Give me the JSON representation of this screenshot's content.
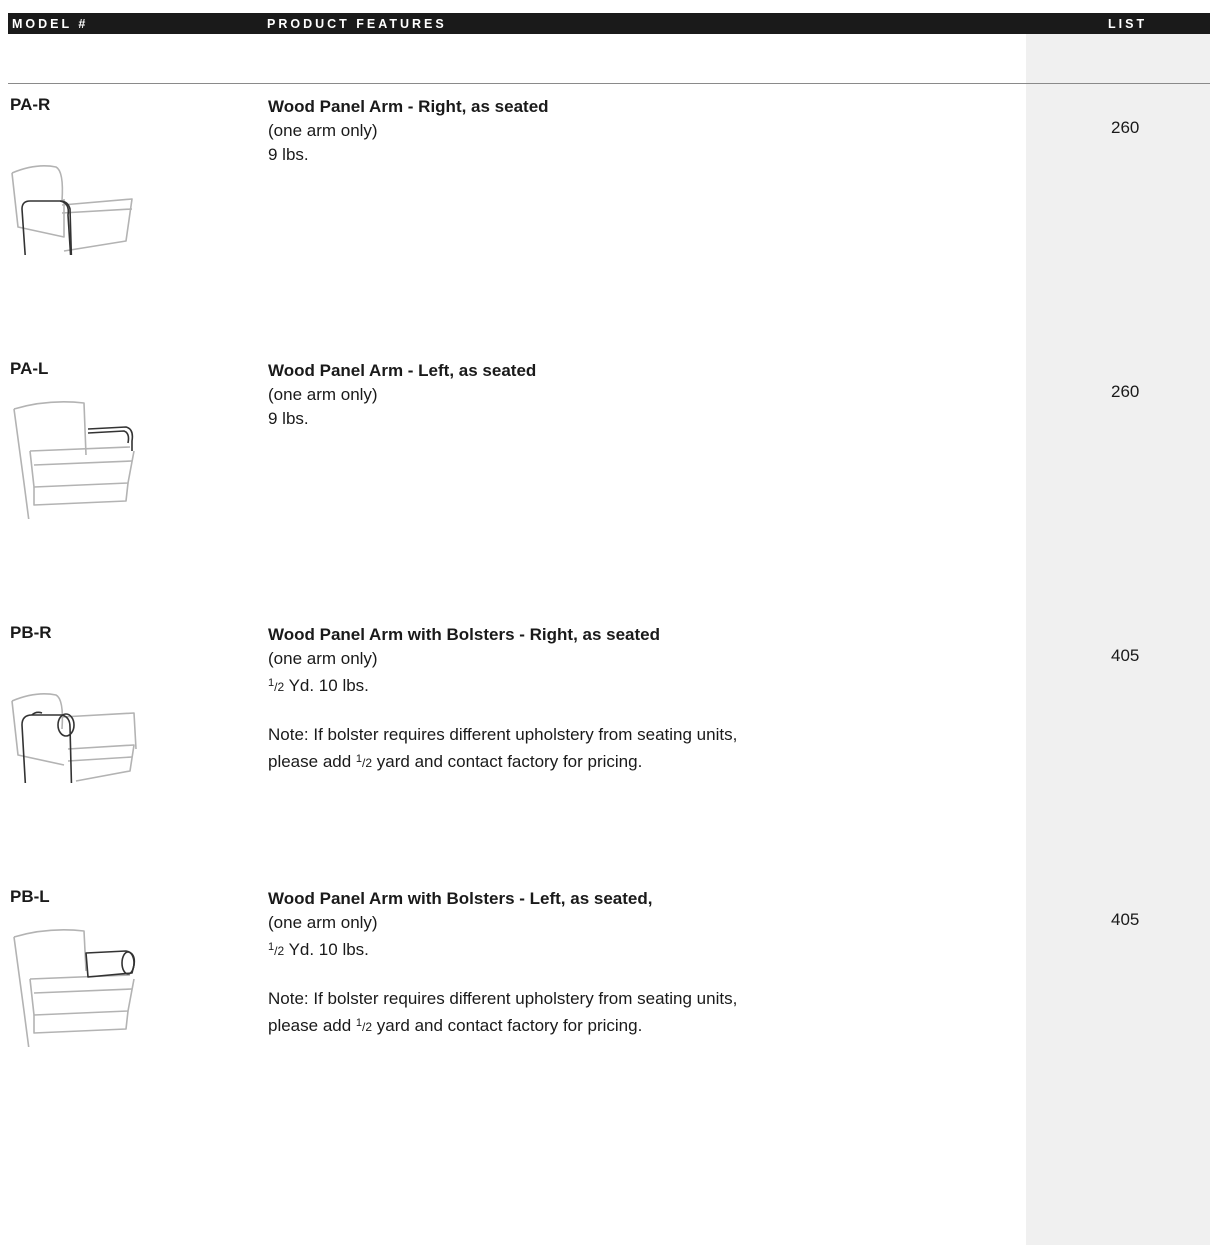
{
  "header": {
    "model_label": "MODEL #",
    "features_label": "PRODUCT FEATURES",
    "list_label": "LIST"
  },
  "products": [
    {
      "model": "PA-R",
      "title": "Wood Panel Arm - Right, as seated",
      "line1": "(one arm only)",
      "weight": "9 lbs.",
      "price": "260",
      "thumb_icon": "lounge-chair-right-arm-icon"
    },
    {
      "model": "PA-L",
      "title": "Wood Panel Arm - Left, as seated",
      "line1": "(one arm only)",
      "weight": "9 lbs.",
      "price": "260",
      "thumb_icon": "lounge-chair-left-arm-icon"
    },
    {
      "model": "PB-R",
      "title": "Wood Panel Arm with Bolsters - Right, as seated",
      "line1": "(one arm only)",
      "frac_num": "1",
      "frac_den": "2",
      "yd_text": " Yd.  10 lbs.",
      "note_line1": "Note: If bolster requires different upholstery from seating units,",
      "note_pre": "please add ",
      "note_post": " yard and contact factory for pricing.",
      "price": "405",
      "thumb_icon": "lounge-chair-right-bolster-icon"
    },
    {
      "model": "PB-L",
      "title": "Wood Panel Arm with Bolsters - Left, as seated,",
      "line1": "(one arm only)",
      "frac_num": "1",
      "frac_den": "2",
      "yd_text": " Yd.  10 lbs.",
      "note_line1": "Note: If bolster requires different upholstery from seating units,",
      "note_pre": "please add ",
      "note_post": " yard and contact factory for pricing.",
      "price": "405",
      "thumb_icon": "lounge-chair-left-bolster-icon"
    }
  ]
}
